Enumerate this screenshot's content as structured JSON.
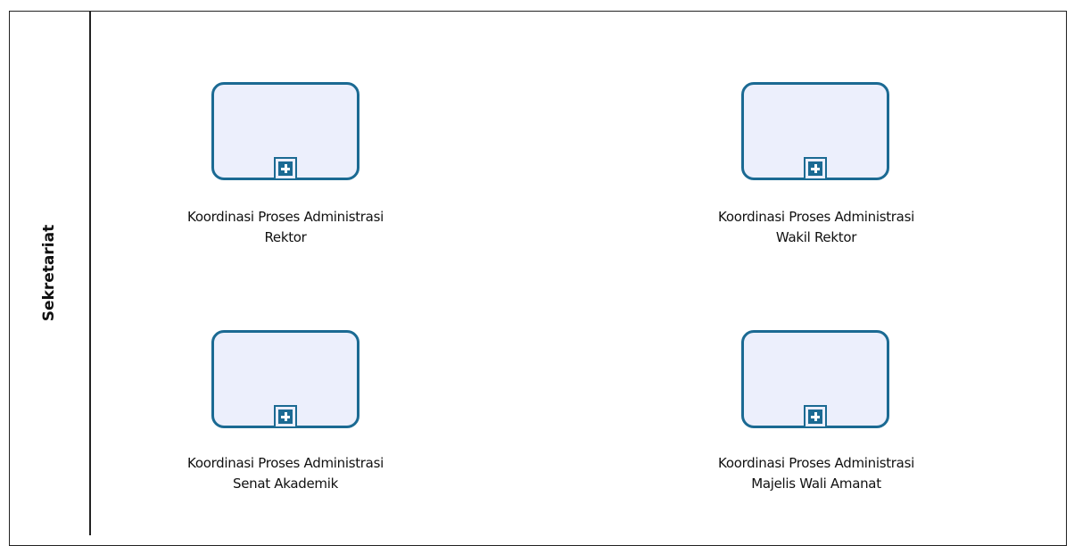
{
  "lane": {
    "label": "Sekretariat"
  },
  "tasks": [
    {
      "id": "rektor",
      "label_lines": [
        "Koordinasi Proses Administrasi",
        "Rektor"
      ],
      "marker": "plus-icon"
    },
    {
      "id": "wakil-rektor",
      "label_lines": [
        "Koordinasi Proses Administrasi",
        "Wakil Rektor"
      ],
      "marker": "plus-icon"
    },
    {
      "id": "senat-akademik",
      "label_lines": [
        "Koordinasi Proses Administrasi",
        "Senat Akademik"
      ],
      "marker": "plus-icon"
    },
    {
      "id": "majelis-wali-amanat",
      "label_lines": [
        "Koordinasi Proses Administrasi",
        "Majelis Wali Amanat"
      ],
      "marker": "plus-icon"
    }
  ],
  "colors": {
    "task_border": "#1b6a93",
    "task_fill": "#eceffc",
    "pool_border": "#222222"
  }
}
